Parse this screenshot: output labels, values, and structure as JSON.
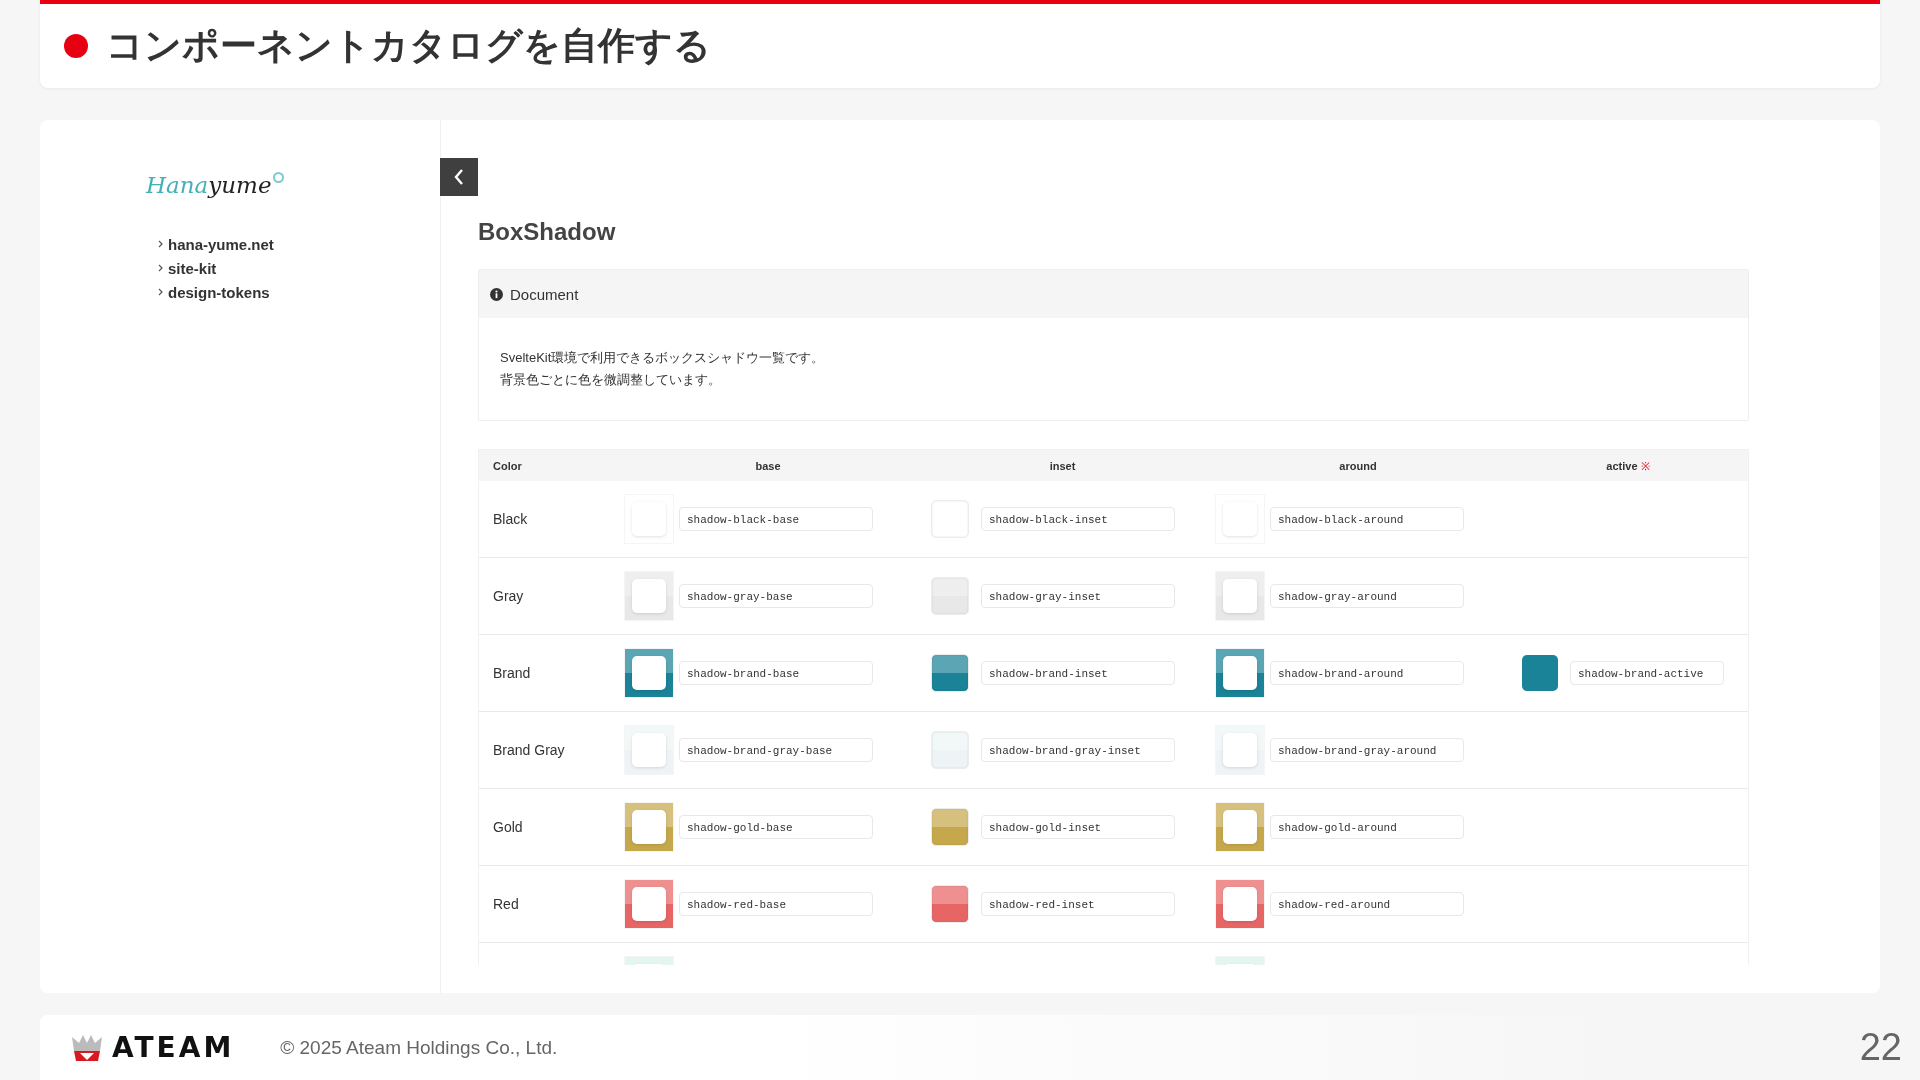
{
  "slide_title": "コンポーネントカタログを自作する",
  "sidebar": {
    "logo": {
      "accent": "Hana",
      "rest": "yume"
    },
    "links": [
      {
        "label": "hana-yume.net"
      },
      {
        "label": "site-kit"
      },
      {
        "label": "design-tokens"
      }
    ]
  },
  "page": {
    "heading": "BoxShadow",
    "document": {
      "title": "Document",
      "lines": [
        "SvelteKit環境で利用できるボックスシャドウ一覧です。",
        "背景色ごとに色を微調整しています。"
      ]
    },
    "table": {
      "columns": [
        {
          "label": "Color"
        },
        {
          "label": "base"
        },
        {
          "label": "inset"
        },
        {
          "label": "around"
        },
        {
          "label": "active",
          "mark": "※"
        }
      ],
      "rows": [
        {
          "color": "#ffffff",
          "cells": [
            {
              "kind": "name",
              "text": "Black"
            },
            {
              "kind": "base",
              "label": "shadow-black-base"
            },
            {
              "kind": "inset",
              "label": "shadow-black-inset"
            },
            {
              "kind": "around",
              "label": "shadow-black-around"
            }
          ]
        },
        {
          "color": "#e8e8e8",
          "cells": [
            {
              "kind": "name",
              "text": "Gray"
            },
            {
              "kind": "base",
              "label": "shadow-gray-base"
            },
            {
              "kind": "inset",
              "label": "shadow-gray-inset"
            },
            {
              "kind": "around",
              "label": "shadow-gray-around"
            }
          ]
        },
        {
          "color": "#1b8397",
          "cells": [
            {
              "kind": "name",
              "text": "Brand"
            },
            {
              "kind": "base",
              "label": "shadow-brand-base"
            },
            {
              "kind": "inset",
              "label": "shadow-brand-inset"
            },
            {
              "kind": "around",
              "label": "shadow-brand-around"
            },
            {
              "kind": "active",
              "label": "shadow-brand-active"
            }
          ]
        },
        {
          "color": "#eef4f5",
          "cells": [
            {
              "kind": "name",
              "text": "Brand Gray"
            },
            {
              "kind": "base",
              "label": "shadow-brand-gray-base"
            },
            {
              "kind": "inset",
              "label": "shadow-brand-gray-inset"
            },
            {
              "kind": "around",
              "label": "shadow-brand-gray-around"
            }
          ]
        },
        {
          "color": "#c6a84c",
          "cells": [
            {
              "kind": "name",
              "text": "Gold"
            },
            {
              "kind": "base",
              "label": "shadow-gold-base"
            },
            {
              "kind": "inset",
              "label": "shadow-gold-inset"
            },
            {
              "kind": "around",
              "label": "shadow-gold-around"
            }
          ]
        },
        {
          "color": "#e86565",
          "cells": [
            {
              "kind": "name",
              "text": "Red"
            },
            {
              "kind": "base",
              "label": "shadow-red-base"
            },
            {
              "kind": "inset",
              "label": "shadow-red-inset"
            },
            {
              "kind": "around",
              "label": "shadow-red-around"
            }
          ]
        },
        {
          "color": "#d9f3e8",
          "cells": [
            {
              "kind": "empty"
            },
            {
              "kind": "base"
            },
            {
              "kind": "empty"
            },
            {
              "kind": "around"
            }
          ]
        }
      ]
    }
  },
  "footer": {
    "brand": "ATEAM",
    "copyright": "© 2025 Ateam Holdings Co., Ltd.",
    "page_number": "22"
  }
}
